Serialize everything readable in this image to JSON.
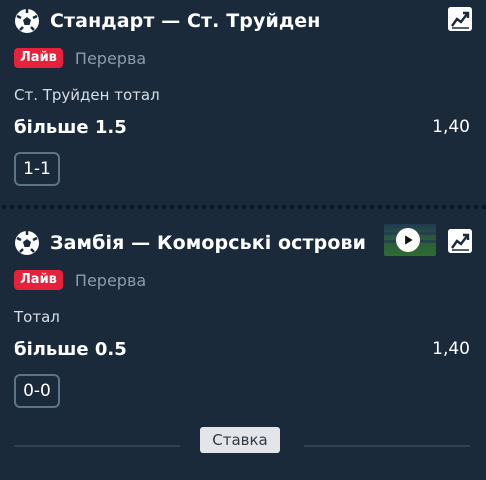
{
  "matches": [
    {
      "title": "Стандарт — Ст. Труйден",
      "live_label": "Лайв",
      "status": "Перерва",
      "market": "Ст. Труйден тотал",
      "outcome": "більше 1.5",
      "odds": "1,40",
      "score": "1-1",
      "has_video": false
    },
    {
      "title": "Замбія — Коморські острови",
      "live_label": "Лайв",
      "status": "Перерва",
      "market": "Тотал",
      "outcome": "більше 0.5",
      "odds": "1,40",
      "score": "0-0",
      "has_video": true
    }
  ],
  "bottom": {
    "tooltip": "Ставка"
  },
  "colors": {
    "background": "#1a2a3b",
    "live_badge": "#e6213b",
    "muted_text": "#8d9bab"
  },
  "icons": {
    "sport": "soccer-ball-icon",
    "stats": "chart-trend-icon",
    "video": "play-icon"
  }
}
